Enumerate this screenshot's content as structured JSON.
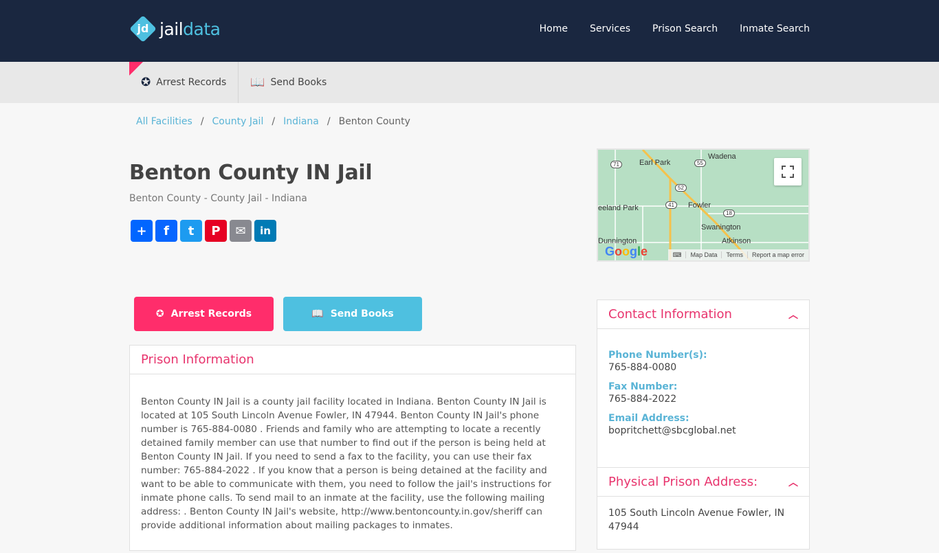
{
  "header": {
    "logo_mark": "jd",
    "logo_part1": "jail",
    "logo_part2": "data",
    "nav": [
      "Home",
      "Services",
      "Prison Search",
      "Inmate Search"
    ]
  },
  "subnav": {
    "items": [
      {
        "label": "Arrest Records",
        "icon": "star-badge-icon"
      },
      {
        "label": "Send Books",
        "icon": "book-icon"
      }
    ]
  },
  "breadcrumb": {
    "links": [
      "All Facilities",
      "County Jail",
      "Indiana"
    ],
    "separator": "/",
    "current": "Benton County"
  },
  "page": {
    "title": "Benton County IN Jail",
    "subtitle": "Benton County - County Jail - Indiana"
  },
  "share": [
    {
      "name": "share",
      "glyph": "+",
      "color": "#0166ff"
    },
    {
      "name": "facebook",
      "glyph": "f",
      "color": "#0866ff"
    },
    {
      "name": "twitter",
      "glyph": "t",
      "color": "#1d9bf0"
    },
    {
      "name": "pinterest",
      "glyph": "P",
      "color": "#e60023"
    },
    {
      "name": "email",
      "glyph": "✉",
      "color": "#888990"
    },
    {
      "name": "linkedin",
      "glyph": "in",
      "color": "#007bb5"
    }
  ],
  "map": {
    "places": [
      "Earl Park",
      "Wadena",
      "eeland Park",
      "Fowler",
      "Swanington",
      "Atkinson",
      "Dunnington"
    ],
    "routes": [
      "71",
      "55",
      "52",
      "41",
      "18"
    ],
    "google": "Google",
    "footer": [
      "⌨",
      "Map Data",
      "Terms",
      "Report a map error"
    ]
  },
  "cta": {
    "arrest": "Arrest Records",
    "books": "Send Books"
  },
  "prison_info": {
    "heading": "Prison Information",
    "text": "Benton County IN Jail is a county jail facility located in Indiana. Benton County IN Jail is located at 105 South Lincoln Avenue Fowler, IN 47944. Benton County IN Jail's phone number is 765-884-0080 . Friends and family who are attempting to locate a recently detained family member can use that number to find out if the person is being held at Benton County IN Jail. If you need to send a fax to the facility, you can use their fax number: 765-884-2022 . If you know that a person is being detained at the facility and want to be able to communicate with them, you need to follow the jail's instructions for inmate phone calls. To send mail to an inmate at the facility, use the following mailing address: . Benton County IN Jail's website, http://www.bentoncounty.in.gov/sheriff can provide additional information about mailing packages to inmates."
  },
  "contact": {
    "heading": "Contact Information",
    "phone_label": "Phone Number(s):",
    "phone": "765-884-0080",
    "fax_label": "Fax Number:",
    "fax": "765-884-2022",
    "email_label": "Email Address:",
    "email": "bopritchett@sbcglobal.net"
  },
  "address": {
    "heading": "Physical Prison Address:",
    "text": "105 South Lincoln Avenue Fowler, IN 47944"
  },
  "colors": {
    "navy": "#1a2740",
    "pink": "#ff2d6b",
    "cyan": "#4ec0e0",
    "heading_pink": "#e8356e",
    "label_blue": "#5ab4d6"
  }
}
